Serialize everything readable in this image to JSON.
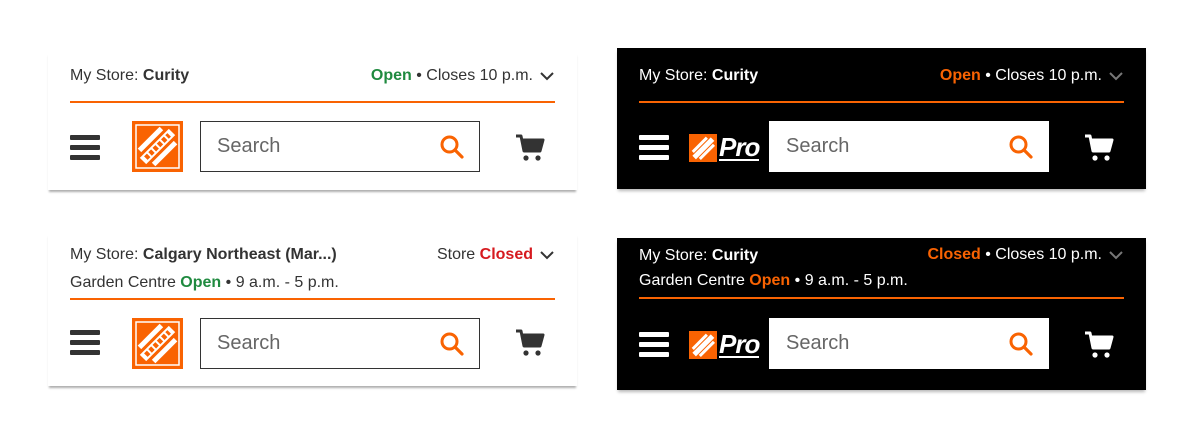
{
  "colors": {
    "brand_orange": "#f96302",
    "open_green": "#1f8a3f",
    "closed_red": "#d61a1f",
    "text_dark": "#333333"
  },
  "headers": [
    {
      "theme": "light",
      "store_label": "My Store:",
      "store_name": "Curity",
      "status": "Open",
      "status_suffix": "• Closes 10 p.m.",
      "logo": "home-depot-logo",
      "search": {
        "placeholder": "Search"
      }
    },
    {
      "theme": "dark",
      "store_label": "My Store:",
      "store_name": "Curity",
      "status": "Open",
      "status_suffix": "• Closes 10 p.m.",
      "logo": "home-depot-pro-logo",
      "pro_label": "Pro",
      "search": {
        "placeholder": "Search"
      }
    },
    {
      "theme": "light",
      "store_label": "My Store:",
      "store_name": "Calgary Northeast (Mar...)",
      "status_prefix": "Store",
      "status": "Closed",
      "garden_label": "Garden Centre",
      "garden_status": "Open",
      "garden_hours": "• 9 a.m. - 5 p.m.",
      "logo": "home-depot-logo",
      "search": {
        "placeholder": "Search"
      }
    },
    {
      "theme": "dark",
      "store_label": "My Store:",
      "store_name": "Curity",
      "status": "Closed",
      "status_suffix": "• Closes 10 p.m.",
      "garden_label": "Garden Centre",
      "garden_status": "Open",
      "garden_hours": "• 9 a.m. - 5 p.m.",
      "logo": "home-depot-pro-logo",
      "pro_label": "Pro",
      "search": {
        "placeholder": "Search"
      }
    }
  ],
  "icons": [
    "hamburger-menu-icon",
    "search-icon",
    "cart-icon",
    "chevron-down-icon"
  ]
}
